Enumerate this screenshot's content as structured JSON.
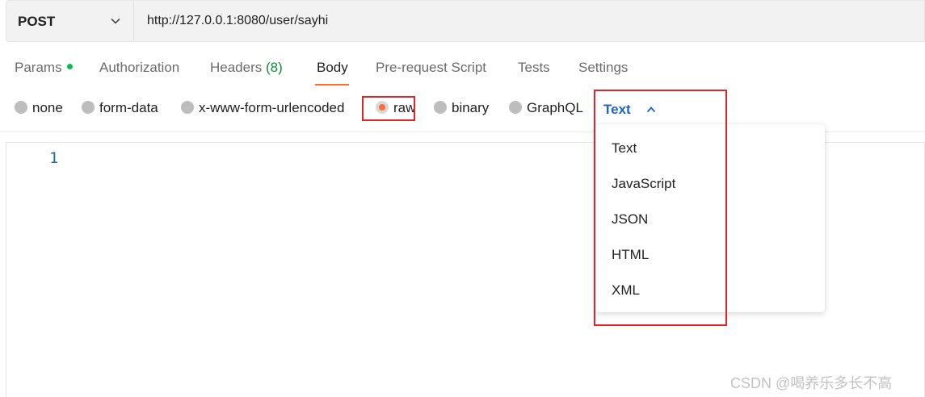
{
  "request": {
    "method": "POST",
    "url": "http://127.0.0.1:8080/user/sayhi"
  },
  "tabs": [
    {
      "label": "Params",
      "has_dot": true
    },
    {
      "label": "Authorization"
    },
    {
      "label": "Headers",
      "count": "(8)"
    },
    {
      "label": "Body",
      "active": true
    },
    {
      "label": "Pre-request Script"
    },
    {
      "label": "Tests"
    },
    {
      "label": "Settings"
    }
  ],
  "body_types": [
    {
      "label": "none"
    },
    {
      "label": "form-data"
    },
    {
      "label": "x-www-form-urlencoded"
    },
    {
      "label": "raw",
      "selected": true
    },
    {
      "label": "binary"
    },
    {
      "label": "GraphQL"
    }
  ],
  "format": {
    "selected": "Text",
    "options": [
      "Text",
      "JavaScript",
      "JSON",
      "HTML",
      "XML"
    ]
  },
  "editor": {
    "line_numbers": [
      "1"
    ]
  },
  "colors": {
    "accent_orange": "#ff6c37",
    "link_blue": "#1c64c9",
    "annotation_red": "#e02525",
    "params_dot_green": "#0cbb52"
  },
  "watermark": "CSDN @喝养乐多长不高"
}
